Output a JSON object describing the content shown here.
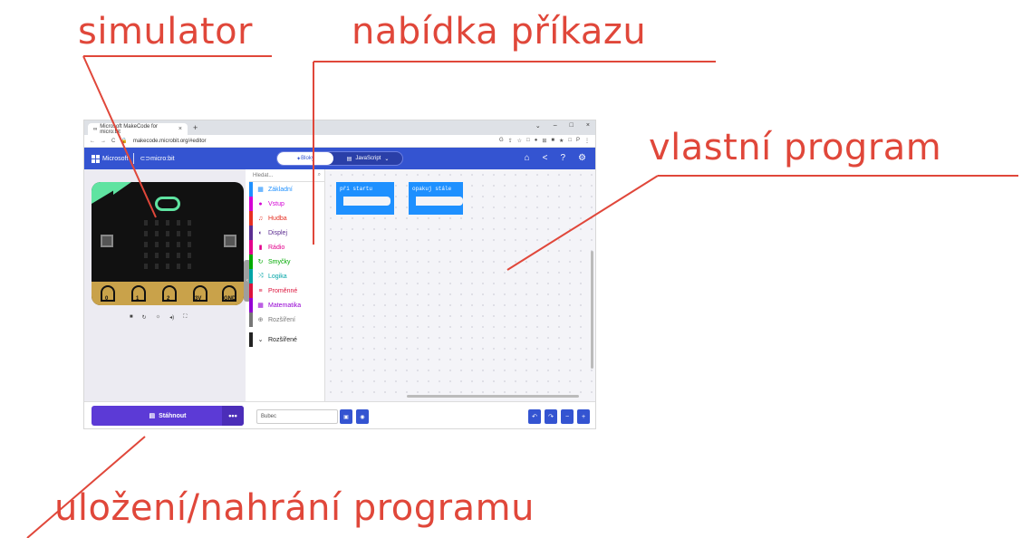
{
  "annotations": {
    "simulator": "simulator",
    "commands": "nabídka příkazu",
    "program": "vlastní program",
    "save": "uložení/nahrání programu"
  },
  "browser": {
    "tab_title": "Microsoft MakeCode for micro:bit",
    "tab_close": "×",
    "new_tab": "+",
    "window_controls": [
      "⌄",
      "–",
      "□",
      "×"
    ],
    "nav": [
      "←",
      "→",
      "C"
    ],
    "url": "makecode.microbit.org/#editor",
    "extension_icons": [
      "G",
      "⇪",
      "☆",
      "□",
      "●",
      "⊞",
      "■",
      "★",
      "□",
      "P",
      "⋮"
    ]
  },
  "makecode_header": {
    "brand": "Microsoft",
    "product": "micro:bit",
    "blocks_label": "Bloky",
    "javascript_label": "JavaScript",
    "icons": [
      "home-icon",
      "share-icon",
      "help-icon",
      "settings-icon"
    ]
  },
  "simulator": {
    "pin_labels": [
      "0",
      "1",
      "2",
      "3V",
      "GND"
    ],
    "controls": [
      "■",
      "↻",
      "☼",
      "◂)",
      "⛶"
    ]
  },
  "toolbox": {
    "search_placeholder": "Hledat...",
    "categories": [
      {
        "label": "Základní",
        "color": "#1e90ff",
        "icon": "▦"
      },
      {
        "label": "Vstup",
        "color": "#d400d4",
        "icon": "●"
      },
      {
        "label": "Hudba",
        "color": "#e63022",
        "icon": "♫"
      },
      {
        "label": "Displej",
        "color": "#5c2d91",
        "icon": "◐"
      },
      {
        "label": "Rádio",
        "color": "#e3008c",
        "icon": "▮"
      },
      {
        "label": "Smyčky",
        "color": "#00aa00",
        "icon": "↻"
      },
      {
        "label": "Logika",
        "color": "#00a4a6",
        "icon": "⤨"
      },
      {
        "label": "Proměnné",
        "color": "#dc143c",
        "icon": "≡"
      },
      {
        "label": "Matematika",
        "color": "#9400d3",
        "icon": "▦"
      },
      {
        "label": "Rozšíření",
        "color": "#777777",
        "icon": "⊕"
      },
      {
        "label": "Rozšířené",
        "color": "#222222",
        "icon": "⌄"
      }
    ]
  },
  "blocks": {
    "on_start": "při startu",
    "forever": "opakuj stále"
  },
  "bottom": {
    "download_label": "Stáhnout",
    "more": "•••",
    "project_name": "Bubec",
    "undo": "↶",
    "redo": "↷",
    "zoom_out": "−",
    "zoom_in": "+"
  }
}
